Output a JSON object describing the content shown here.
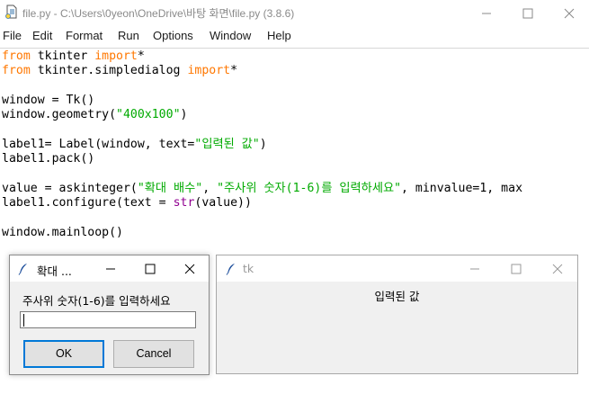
{
  "window": {
    "title": "file.py - C:\\Users\\0yeon\\OneDrive\\바탕 화면\\file.py (3.8.6)"
  },
  "menu": [
    "File",
    "Edit",
    "Format",
    "Run",
    "Options",
    "Window",
    "Help"
  ],
  "code": {
    "line1": {
      "kw1": "from",
      "mod": " tkinter ",
      "kw2": "import",
      "rest": "*"
    },
    "line2": {
      "kw1": "from",
      "mod": " tkinter.simpledialog ",
      "kw2": "import",
      "rest": "*"
    },
    "line4": "window = Tk()",
    "line5": {
      "pre": "window.geometry(",
      "str": "\"400x100\"",
      "post": ")"
    },
    "line7": {
      "pre": "label1= Label(window, text=",
      "str": "\"입력된 값\"",
      "post": ")"
    },
    "line8": "label1.pack()",
    "line10": {
      "pre": "value = askinteger(",
      "str1": "\"확대 배수\"",
      "mid": ", ",
      "str2": "\"주사위 숫자(1-6)를 입력하세요\"",
      "post": ", minvalue=1, max"
    },
    "line11": {
      "pre": "label1.configure(text = ",
      "bi": "str",
      "post": "(value))"
    },
    "line13": "window.mainloop()"
  },
  "dialog": {
    "title": "확대 ...",
    "prompt": "주사위 숫자(1-6)를 입력하세요",
    "input_value": "",
    "ok_label": "OK",
    "cancel_label": "Cancel"
  },
  "tk_window": {
    "title": "tk",
    "label": "입력된 값"
  },
  "colors": {
    "keyword": "#ff7700",
    "string": "#00aa00",
    "builtin": "#900090",
    "focus_border": "#0078d7"
  }
}
